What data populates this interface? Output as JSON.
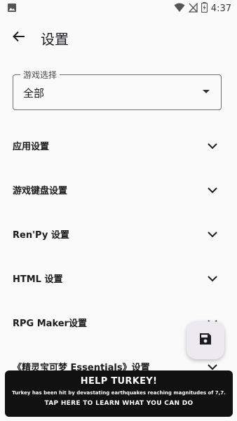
{
  "status_bar": {
    "time": "4:37",
    "icons": [
      "image-notification-icon",
      "wifi-icon",
      "no-signal-icon",
      "battery-charging-icon"
    ]
  },
  "app_bar": {
    "title": "设置",
    "back_icon": "arrow-back-icon"
  },
  "game_select": {
    "label": "游戏选择",
    "value": "全部"
  },
  "sections": [
    {
      "label": "应用设置"
    },
    {
      "label": "游戏键盘设置"
    },
    {
      "label": "Ren'Py 设置"
    },
    {
      "label": "HTML 设置"
    },
    {
      "label": "RPG Maker设置"
    },
    {
      "label": "《精灵宝可梦 Essentials》设置"
    }
  ],
  "fab": {
    "icon": "save-icon"
  },
  "banner": {
    "title": "HELP TURKEY!",
    "text": "Turkey has been hit by devastating earthquakes reaching magnitudes of 7,7.",
    "cta": "TAP HERE TO LEARN WHAT YOU CAN DO"
  },
  "colors": {
    "background": "#fafafa",
    "banner_background": "#111111",
    "fab_background": "#eceaf0"
  }
}
